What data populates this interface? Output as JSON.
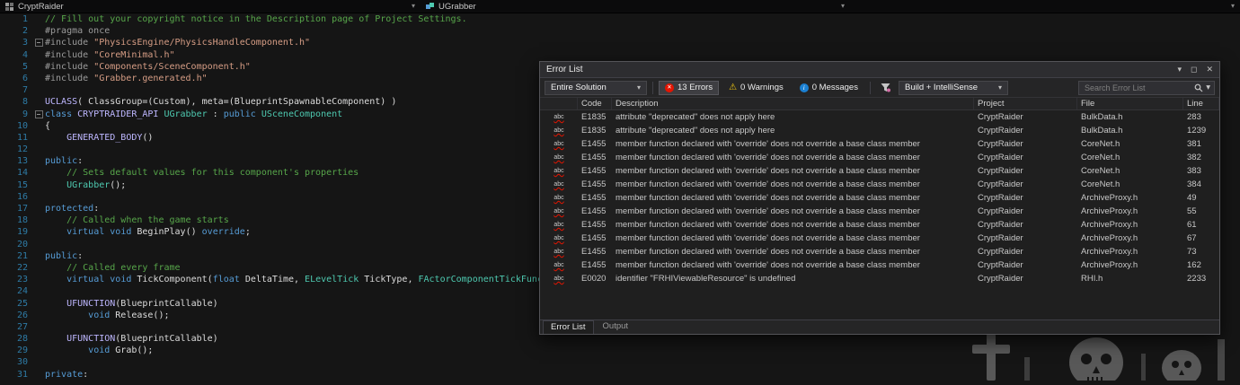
{
  "icons": {
    "chevron_down": "▾",
    "close": "✕",
    "maximize": "◻",
    "pin_menu": "▾",
    "warning": "⚠",
    "info": "i",
    "error_x": "✕",
    "fold_collapse": "−",
    "intellisense": "abc"
  },
  "colors": {
    "error": "#e51400",
    "warning": "#f2c811",
    "info": "#1b80d2",
    "editor_background": "#151515",
    "panel_background": "#1f1f1f"
  },
  "nav": {
    "project": "CryptRaider",
    "type": "UGrabber"
  },
  "editor": {
    "lines": [
      {
        "n": 1,
        "fold": false,
        "s": [
          [
            "comment",
            "// Fill out your copyright notice in the Description page of Project Settings."
          ]
        ]
      },
      {
        "n": 2,
        "fold": false,
        "s": [
          [
            "preproc",
            "#pragma once"
          ]
        ]
      },
      {
        "n": 3,
        "fold": true,
        "s": [
          [
            "preproc",
            "#include "
          ],
          [
            "string",
            "\"PhysicsEngine/PhysicsHandleComponent.h\""
          ]
        ]
      },
      {
        "n": 4,
        "fold": false,
        "s": [
          [
            "preproc",
            "#include "
          ],
          [
            "string",
            "\"CoreMinimal.h\""
          ]
        ]
      },
      {
        "n": 5,
        "fold": false,
        "s": [
          [
            "preproc",
            "#include "
          ],
          [
            "string",
            "\"Components/SceneComponent.h\""
          ]
        ]
      },
      {
        "n": 6,
        "fold": false,
        "s": [
          [
            "preproc",
            "#include "
          ],
          [
            "string",
            "\"Grabber.generated.h\""
          ]
        ]
      },
      {
        "n": 7,
        "fold": false,
        "s": []
      },
      {
        "n": 8,
        "fold": false,
        "s": [
          [
            "macro",
            "UCLASS"
          ],
          [
            "plain",
            "( ClassGroup=(Custom), meta=(BlueprintSpawnableComponent) )"
          ]
        ]
      },
      {
        "n": 9,
        "fold": true,
        "s": [
          [
            "keyword",
            "class "
          ],
          [
            "macro",
            "CRYPTRAIDER_API "
          ],
          [
            "type",
            "UGrabber"
          ],
          [
            "plain",
            " : "
          ],
          [
            "keyword",
            "public"
          ],
          [
            "plain",
            " "
          ],
          [
            "type",
            "USceneComponent"
          ]
        ]
      },
      {
        "n": 10,
        "fold": false,
        "s": [
          [
            "plain",
            "{"
          ]
        ]
      },
      {
        "n": 11,
        "fold": false,
        "s": [
          [
            "plain",
            "    "
          ],
          [
            "macro",
            "GENERATED_BODY"
          ],
          [
            "plain",
            "()"
          ]
        ]
      },
      {
        "n": 12,
        "fold": false,
        "s": []
      },
      {
        "n": 13,
        "fold": false,
        "s": [
          [
            "keyword",
            "public"
          ],
          [
            "plain",
            ":"
          ]
        ]
      },
      {
        "n": 14,
        "fold": false,
        "s": [
          [
            "plain",
            "    "
          ],
          [
            "comment",
            "// Sets default values for this component's properties"
          ]
        ]
      },
      {
        "n": 15,
        "fold": false,
        "s": [
          [
            "plain",
            "    "
          ],
          [
            "type",
            "UGrabber"
          ],
          [
            "plain",
            "();"
          ]
        ]
      },
      {
        "n": 16,
        "fold": false,
        "s": []
      },
      {
        "n": 17,
        "fold": false,
        "s": [
          [
            "keyword",
            "protected"
          ],
          [
            "plain",
            ":"
          ]
        ]
      },
      {
        "n": 18,
        "fold": false,
        "s": [
          [
            "plain",
            "    "
          ],
          [
            "comment",
            "// Called when the game starts"
          ]
        ]
      },
      {
        "n": 19,
        "fold": false,
        "s": [
          [
            "plain",
            "    "
          ],
          [
            "keyword",
            "virtual"
          ],
          [
            "plain",
            " "
          ],
          [
            "keyword",
            "void"
          ],
          [
            "plain",
            " BeginPlay() "
          ],
          [
            "keyword",
            "override"
          ],
          [
            "plain",
            ";"
          ]
        ]
      },
      {
        "n": 20,
        "fold": false,
        "s": []
      },
      {
        "n": 21,
        "fold": false,
        "s": [
          [
            "keyword",
            "public"
          ],
          [
            "plain",
            ":"
          ]
        ]
      },
      {
        "n": 22,
        "fold": false,
        "s": [
          [
            "plain",
            "    "
          ],
          [
            "comment",
            "// Called every frame"
          ]
        ]
      },
      {
        "n": 23,
        "fold": false,
        "s": [
          [
            "plain",
            "    "
          ],
          [
            "keyword",
            "virtual"
          ],
          [
            "plain",
            " "
          ],
          [
            "keyword",
            "void"
          ],
          [
            "plain",
            " TickComponent("
          ],
          [
            "keyword",
            "float"
          ],
          [
            "plain",
            " DeltaTime, "
          ],
          [
            "type",
            "ELevelTick"
          ],
          [
            "plain",
            " TickType, "
          ],
          [
            "type",
            "FActorComponentTickFunc"
          ]
        ]
      },
      {
        "n": 24,
        "fold": false,
        "s": []
      },
      {
        "n": 25,
        "fold": false,
        "s": [
          [
            "plain",
            "    "
          ],
          [
            "macro",
            "UFUNCTION"
          ],
          [
            "plain",
            "(BlueprintCallable)"
          ]
        ]
      },
      {
        "n": 26,
        "fold": false,
        "s": [
          [
            "plain",
            "        "
          ],
          [
            "keyword",
            "void"
          ],
          [
            "plain",
            " Release();"
          ]
        ]
      },
      {
        "n": 27,
        "fold": false,
        "s": []
      },
      {
        "n": 28,
        "fold": false,
        "s": [
          [
            "plain",
            "    "
          ],
          [
            "macro",
            "UFUNCTION"
          ],
          [
            "plain",
            "(BlueprintCallable)"
          ]
        ]
      },
      {
        "n": 29,
        "fold": false,
        "s": [
          [
            "plain",
            "        "
          ],
          [
            "keyword",
            "void"
          ],
          [
            "plain",
            " Grab();"
          ]
        ]
      },
      {
        "n": 30,
        "fold": false,
        "s": []
      },
      {
        "n": 31,
        "fold": false,
        "s": [
          [
            "keyword",
            "private"
          ],
          [
            "plain",
            ":"
          ]
        ]
      }
    ]
  },
  "error_list": {
    "title": "Error List",
    "toolbar": {
      "scope": "Entire Solution",
      "errors": "13 Errors",
      "warnings": "0 Warnings",
      "messages": "0 Messages",
      "source": "Build + IntelliSense",
      "search_placeholder": "Search Error List"
    },
    "columns": {
      "code": "Code",
      "description": "Description",
      "project": "Project",
      "file": "File",
      "line": "Line"
    },
    "rows": [
      {
        "code": "E1835",
        "desc": "attribute \"deprecated\" does not apply here",
        "project": "CryptRaider",
        "file": "BulkData.h",
        "line": "283"
      },
      {
        "code": "E1835",
        "desc": "attribute \"deprecated\" does not apply here",
        "project": "CryptRaider",
        "file": "BulkData.h",
        "line": "1239"
      },
      {
        "code": "E1455",
        "desc": "member function declared with 'override' does not override a base class member",
        "project": "CryptRaider",
        "file": "CoreNet.h",
        "line": "381"
      },
      {
        "code": "E1455",
        "desc": "member function declared with 'override' does not override a base class member",
        "project": "CryptRaider",
        "file": "CoreNet.h",
        "line": "382"
      },
      {
        "code": "E1455",
        "desc": "member function declared with 'override' does not override a base class member",
        "project": "CryptRaider",
        "file": "CoreNet.h",
        "line": "383"
      },
      {
        "code": "E1455",
        "desc": "member function declared with 'override' does not override a base class member",
        "project": "CryptRaider",
        "file": "CoreNet.h",
        "line": "384"
      },
      {
        "code": "E1455",
        "desc": "member function declared with 'override' does not override a base class member",
        "project": "CryptRaider",
        "file": "ArchiveProxy.h",
        "line": "49"
      },
      {
        "code": "E1455",
        "desc": "member function declared with 'override' does not override a base class member",
        "project": "CryptRaider",
        "file": "ArchiveProxy.h",
        "line": "55"
      },
      {
        "code": "E1455",
        "desc": "member function declared with 'override' does not override a base class member",
        "project": "CryptRaider",
        "file": "ArchiveProxy.h",
        "line": "61"
      },
      {
        "code": "E1455",
        "desc": "member function declared with 'override' does not override a base class member",
        "project": "CryptRaider",
        "file": "ArchiveProxy.h",
        "line": "67"
      },
      {
        "code": "E1455",
        "desc": "member function declared with 'override' does not override a base class member",
        "project": "CryptRaider",
        "file": "ArchiveProxy.h",
        "line": "73"
      },
      {
        "code": "E1455",
        "desc": "member function declared with 'override' does not override a base class member",
        "project": "CryptRaider",
        "file": "ArchiveProxy.h",
        "line": "162"
      },
      {
        "code": "E0020",
        "desc": "identifier \"FRHIViewableResource\" is undefined",
        "project": "CryptRaider",
        "file": "RHI.h",
        "line": "2233"
      }
    ],
    "tabs": [
      {
        "label": "Error List",
        "active": true
      },
      {
        "label": "Output",
        "active": false
      }
    ]
  }
}
